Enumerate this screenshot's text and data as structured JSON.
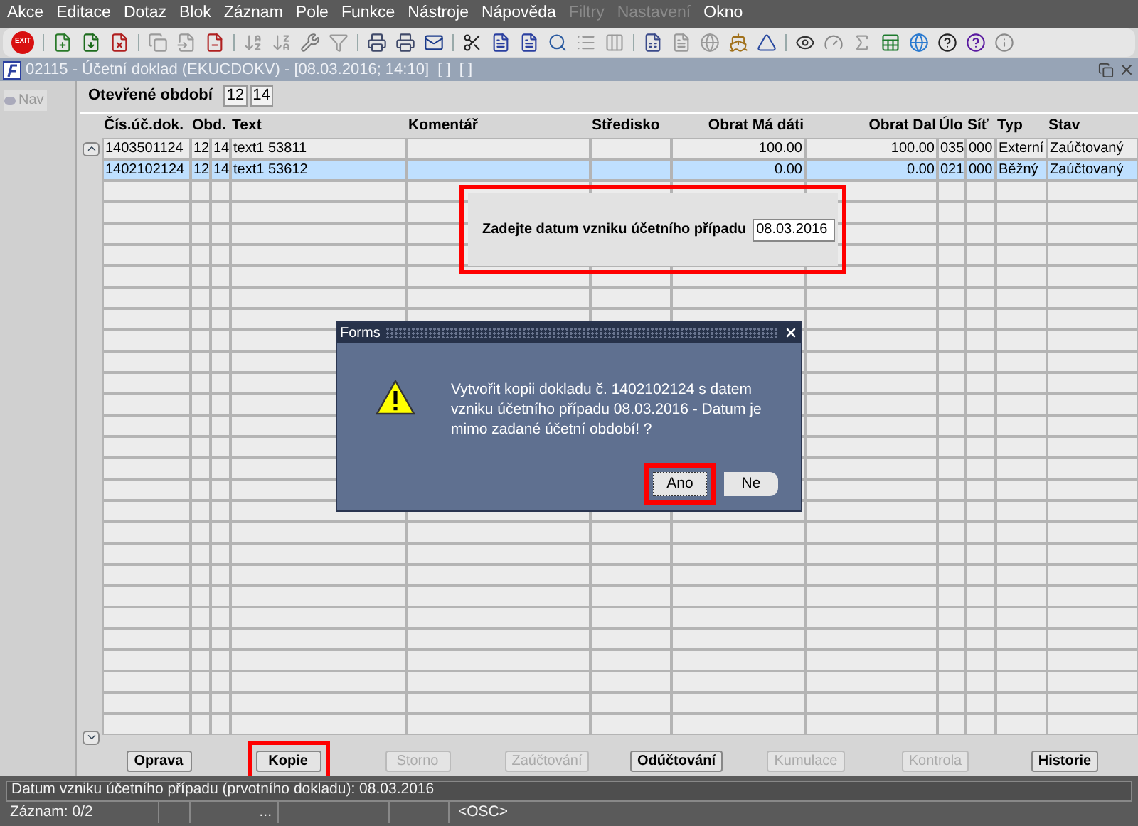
{
  "menu": [
    {
      "label": "Akce",
      "disabled": false
    },
    {
      "label": "Editace",
      "disabled": false
    },
    {
      "label": "Dotaz",
      "disabled": false
    },
    {
      "label": "Blok",
      "disabled": false
    },
    {
      "label": "Záznam",
      "disabled": false
    },
    {
      "label": "Pole",
      "disabled": false
    },
    {
      "label": "Funkce",
      "disabled": false
    },
    {
      "label": "Nástroje",
      "disabled": false
    },
    {
      "label": "Nápověda",
      "disabled": false
    },
    {
      "label": "Filtry",
      "disabled": true
    },
    {
      "label": "Nastavení",
      "disabled": true
    },
    {
      "label": "Okno",
      "disabled": false
    }
  ],
  "toolbar": {
    "exit_label": "EXIT"
  },
  "window": {
    "title": "02115 - Účetní doklad (EKUCDOKV) - [08.03.2016; 14:10]  [ ]  [ ]"
  },
  "nav": {
    "label": "Nav"
  },
  "open_period": {
    "label": "Otevřené období",
    "values": [
      "12",
      "14"
    ]
  },
  "table": {
    "columns": [
      {
        "label": "Čís.úč.dok."
      },
      {
        "label": "Obd."
      },
      {
        "label": "Text"
      },
      {
        "label": "Komentář"
      },
      {
        "label": "Středisko"
      },
      {
        "label": "Obrat Má dáti"
      },
      {
        "label": "Obrat Dal"
      },
      {
        "label": "Úlo"
      },
      {
        "label": "Síť"
      },
      {
        "label": "Typ"
      },
      {
        "label": "Stav"
      }
    ],
    "rows": [
      {
        "cells": [
          "1403501124",
          [
            "12",
            "14"
          ],
          "text1 53811",
          "",
          "",
          "100.00",
          "100.00",
          "035",
          "000",
          "Externí",
          "Zaúčtovaný"
        ],
        "selected": false
      },
      {
        "cells": [
          "1402102124",
          [
            "12",
            "14"
          ],
          "text1 53612",
          "",
          "",
          "0.00",
          "0.00",
          "021",
          "000",
          "Běžný",
          "Zaúčtovaný"
        ],
        "selected": true
      }
    ]
  },
  "date_prompt": {
    "label": "Zadejte datum vzniku účetního případu",
    "value": "08.03.2016",
    "highlighted": true
  },
  "dialog": {
    "title": "Forms",
    "message": "Vytvořit kopii dokladu č. 1402102124 s datem vzniku účetního případu 08.03.2016 - Datum je mimo zadané účetní období! ?",
    "buttons": [
      {
        "label": "Ano",
        "highlighted": true
      },
      {
        "label": "Ne",
        "highlighted": false
      }
    ]
  },
  "buttons": [
    {
      "label": "Oprava",
      "disabled": false,
      "highlighted": false
    },
    {
      "label": "Kopie",
      "disabled": false,
      "highlighted": true
    },
    {
      "label": "Storno",
      "disabled": true,
      "highlighted": false
    },
    {
      "label": "Zaúčtování",
      "disabled": true,
      "highlighted": false
    },
    {
      "label": "Odúčtování",
      "disabled": false,
      "highlighted": false
    },
    {
      "label": "Kumulace",
      "disabled": true,
      "highlighted": false
    },
    {
      "label": "Kontrola",
      "disabled": true,
      "highlighted": false
    },
    {
      "label": "Historie",
      "disabled": false,
      "highlighted": false
    }
  ],
  "status_bar": {
    "message": "Datum vzniku účetního případu (prvotního dokladu): 08.03.2016",
    "record": "Záznam: 0/2",
    "ellipsis": "...",
    "mode": "<OSC>"
  }
}
